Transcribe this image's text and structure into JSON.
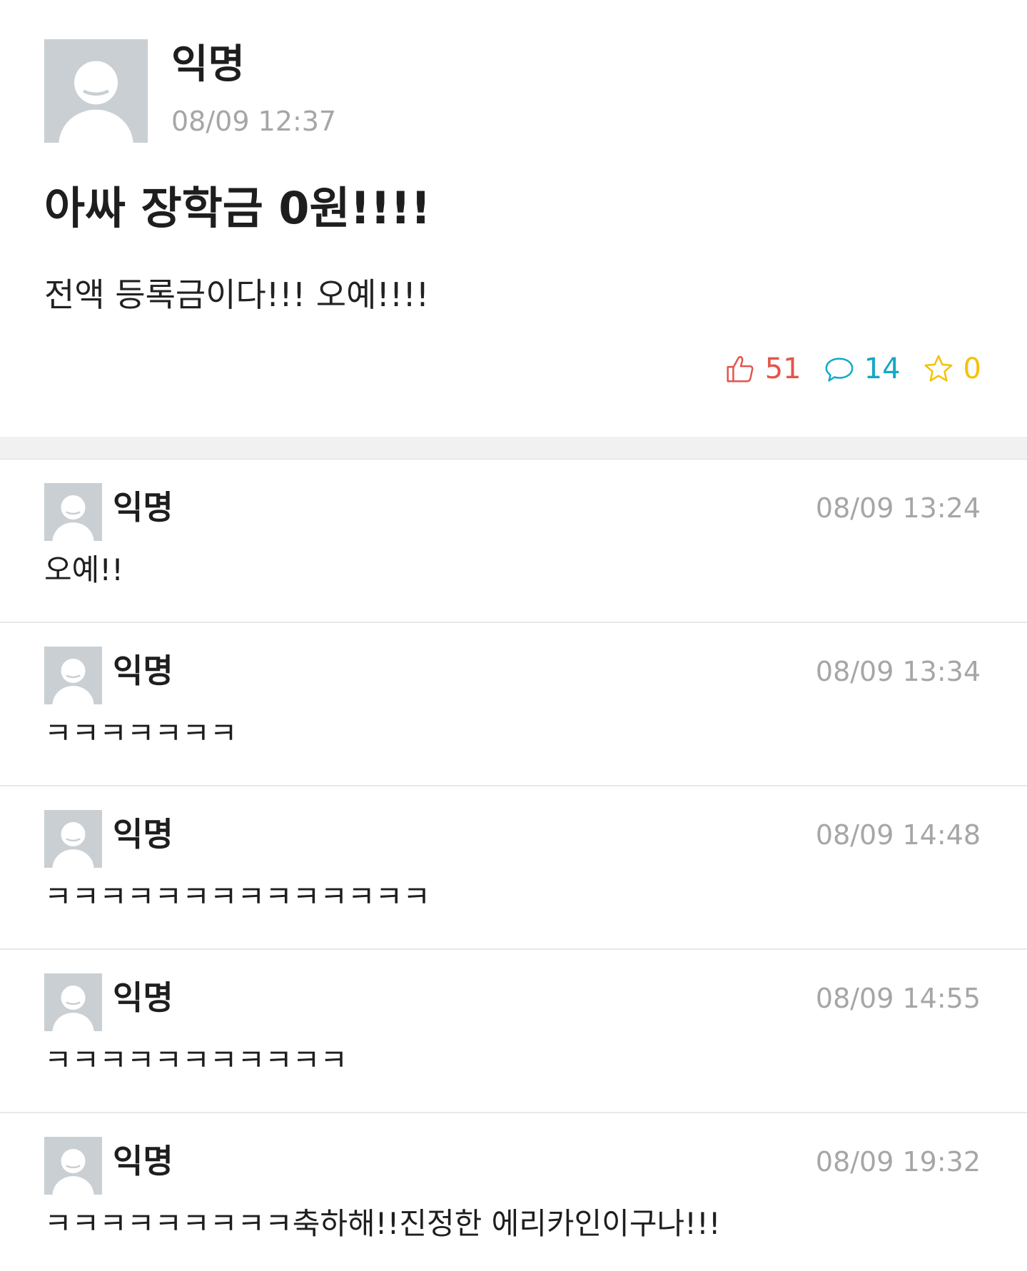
{
  "post": {
    "author": "익명",
    "time": "08/09 12:37",
    "title": "아싸 장학금 0원!!!!",
    "body": "전액 등록금이다!!! 오예!!!!",
    "stats": {
      "votes": "51",
      "comments": "14",
      "scraps": "0"
    }
  },
  "colors": {
    "vote": "#e3554a",
    "comment": "#14a8c6",
    "scrap": "#f5c100",
    "time": "#a6a6a6",
    "avatar_bg": "#c9cfd2"
  },
  "icons": {
    "vote": "thumbs-up-icon",
    "comment": "speech-bubble-icon",
    "scrap": "star-icon",
    "avatar": "default-profile-icon"
  },
  "comments": [
    {
      "author": "익명",
      "time": "08/09 13:24",
      "text": "오예!!"
    },
    {
      "author": "익명",
      "time": "08/09 13:34",
      "text": "ㅋㅋㅋㅋㅋㅋㅋ"
    },
    {
      "author": "익명",
      "time": "08/09 14:48",
      "text": "ㅋㅋㅋㅋㅋㅋㅋㅋㅋㅋㅋㅋㅋㅋ"
    },
    {
      "author": "익명",
      "time": "08/09 14:55",
      "text": "ㅋㅋㅋㅋㅋㅋㅋㅋㅋㅋㅋ"
    },
    {
      "author": "익명",
      "time": "08/09 19:32",
      "text": "ㅋㅋㅋㅋㅋㅋㅋㅋㅋ축하해!!진정한 에리카인이구나!!!"
    }
  ]
}
